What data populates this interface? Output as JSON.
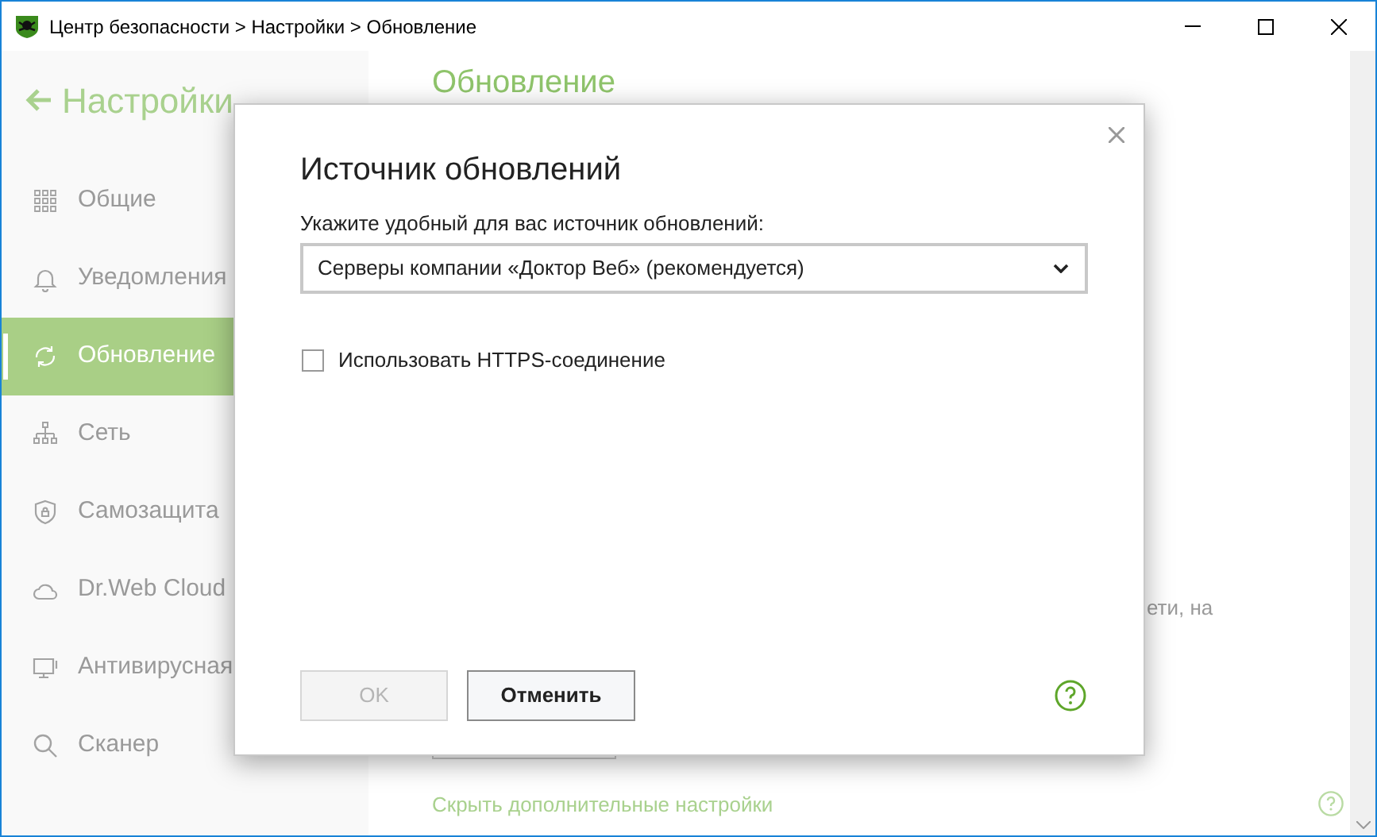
{
  "window": {
    "title": "Центр безопасности > Настройки > Обновление"
  },
  "sidebar": {
    "back_label": "Настройки",
    "items": [
      {
        "label": "Общие",
        "kind": "grid",
        "selected": false
      },
      {
        "label": "Уведомления",
        "kind": "bell",
        "selected": false
      },
      {
        "label": "Обновление",
        "kind": "refresh",
        "selected": true
      },
      {
        "label": "Сеть",
        "kind": "network",
        "selected": false
      },
      {
        "label": "Самозащита",
        "kind": "shield",
        "selected": false
      },
      {
        "label": "Dr.Web Cloud",
        "kind": "cloud",
        "selected": false
      },
      {
        "label": "Антивирусная",
        "kind": "monitor",
        "selected": false
      },
      {
        "label": "Сканер",
        "kind": "search",
        "selected": false
      }
    ]
  },
  "main": {
    "heading": "Обновление",
    "partial_text": "ети, на",
    "link": "Скрыть дополнительные настройки"
  },
  "dialog": {
    "title": "Источник обновлений",
    "source_label": "Укажите удобный для вас источник обновлений:",
    "source_value": "Серверы компании «Доктор Веб» (рекомендуется)",
    "https": {
      "label": "Использовать HTTPS-соединение",
      "checked": false
    },
    "buttons": [
      {
        "label": "OK",
        "disabled": true
      },
      {
        "label": "Отменить",
        "disabled": false
      }
    ]
  }
}
